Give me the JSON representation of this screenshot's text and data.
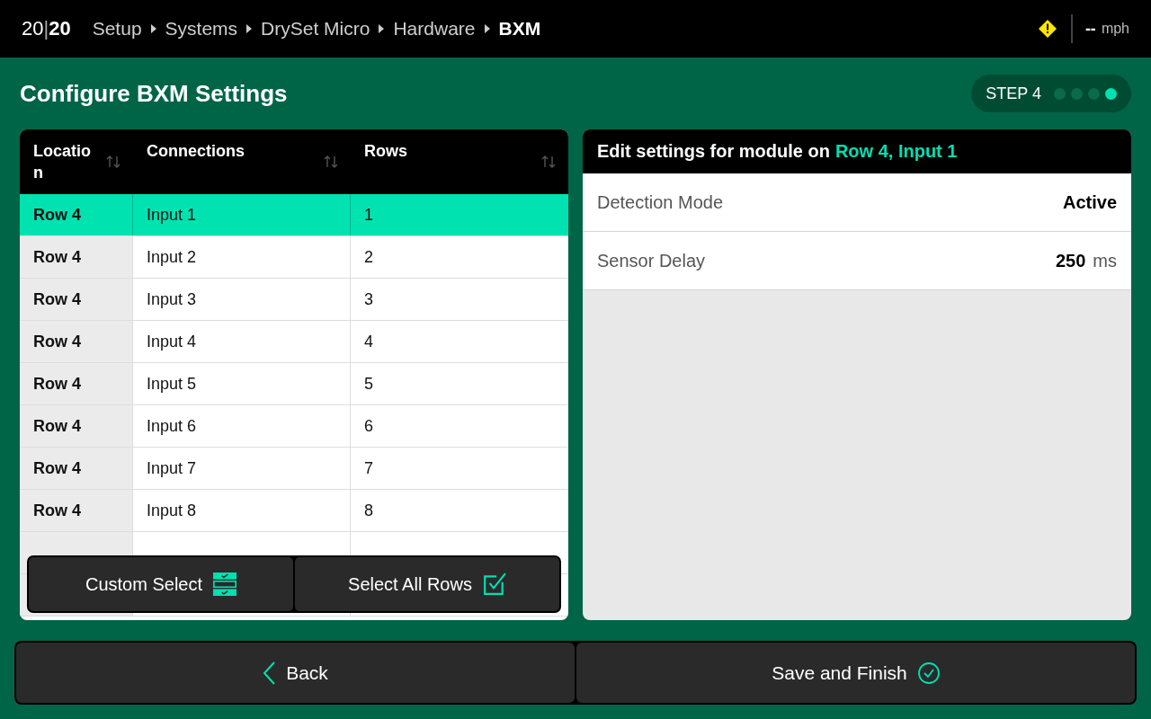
{
  "logo": {
    "light": "20",
    "bar": "|",
    "bold": "20"
  },
  "breadcrumb": [
    {
      "label": "Setup",
      "current": false
    },
    {
      "label": "Systems",
      "current": false
    },
    {
      "label": "DrySet Micro",
      "current": false
    },
    {
      "label": "Hardware",
      "current": false
    },
    {
      "label": "BXM",
      "current": true
    }
  ],
  "status": {
    "warning": true,
    "speed": "--",
    "unit": "mph"
  },
  "title": "Configure BXM Settings",
  "step": {
    "label": "STEP 4",
    "dots": [
      {
        "selected": false
      },
      {
        "selected": false
      },
      {
        "selected": false
      },
      {
        "selected": true
      }
    ]
  },
  "table": {
    "columns": [
      "Location",
      "Connections",
      "Rows"
    ],
    "rows": [
      {
        "location": "Row 4",
        "connection": "Input 1",
        "row": "1",
        "selected": true
      },
      {
        "location": "Row 4",
        "connection": "Input 2",
        "row": "2",
        "selected": false
      },
      {
        "location": "Row 4",
        "connection": "Input 3",
        "row": "3",
        "selected": false
      },
      {
        "location": "Row 4",
        "connection": "Input 4",
        "row": "4",
        "selected": false
      },
      {
        "location": "Row 4",
        "connection": "Input 5",
        "row": "5",
        "selected": false
      },
      {
        "location": "Row 4",
        "connection": "Input 6",
        "row": "6",
        "selected": false
      },
      {
        "location": "Row 4",
        "connection": "Input 7",
        "row": "7",
        "selected": false
      },
      {
        "location": "Row 4",
        "connection": "Input 8",
        "row": "8",
        "selected": false
      }
    ]
  },
  "select_buttons": [
    "Custom Select",
    "Select All Rows"
  ],
  "settings": {
    "heading": "Edit settings for module on",
    "target": "Row 4, Input 1",
    "items": [
      {
        "label": "Detection Mode",
        "value": "Active"
      },
      {
        "label": "Sensor Delay",
        "value": "250",
        "unit": "ms"
      }
    ]
  },
  "footer": {
    "back": "Back",
    "save": "Save and Finish"
  }
}
